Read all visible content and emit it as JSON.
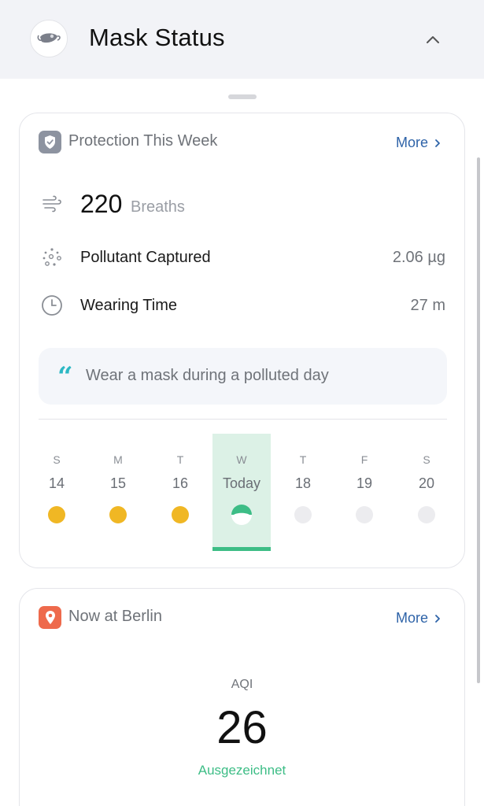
{
  "header": {
    "title": "Mask Status",
    "icon": "mask-icon",
    "collapse_icon": "chevron-up-icon"
  },
  "protection": {
    "title": "Protection This Week",
    "icon": "shield-icon",
    "more_label": "More",
    "breaths": {
      "value": "220",
      "unit": "Breaths",
      "icon": "wind-icon"
    },
    "pollutant": {
      "label": "Pollutant Captured",
      "value": "2.06 µg",
      "icon": "particles-icon"
    },
    "wearing": {
      "label": "Wearing Time",
      "value": "27 m",
      "icon": "clock-icon"
    },
    "tip": "Wear a mask during a polluted day",
    "days": [
      {
        "letter": "S",
        "date": "14",
        "state": "done"
      },
      {
        "letter": "M",
        "date": "15",
        "state": "done"
      },
      {
        "letter": "T",
        "date": "16",
        "state": "done"
      },
      {
        "letter": "W",
        "date": "Today",
        "state": "today"
      },
      {
        "letter": "T",
        "date": "18",
        "state": "future"
      },
      {
        "letter": "F",
        "date": "19",
        "state": "future"
      },
      {
        "letter": "S",
        "date": "20",
        "state": "future"
      }
    ]
  },
  "location": {
    "title": "Now at Berlin",
    "icon": "location-pin-icon",
    "more_label": "More",
    "aqi_label": "AQI",
    "aqi_value": "26",
    "aqi_status": "Ausgezeichnet"
  },
  "colors": {
    "accent_green": "#3dbd86",
    "dot_done": "#f0b724",
    "link_blue": "#2e63a8",
    "location_orange": "#ee6a4c",
    "shield_gray": "#8d93a0"
  }
}
